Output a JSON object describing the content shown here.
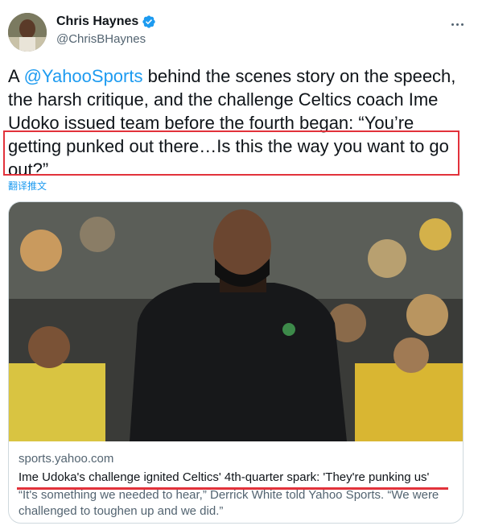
{
  "author": {
    "name": "Chris Haynes",
    "handle": "@ChrisBHaynes",
    "verified": true
  },
  "icons": {
    "verified": "verified-badge-icon",
    "more": "more-options-icon"
  },
  "tweet": {
    "prefix": "A ",
    "mention": "@YahooSports",
    "rest": " behind the scenes story on the speech, the harsh critique, and the challenge Celtics coach Ime Udoko issued team before the fourth began: “You’re getting punked out there…Is this the way you want to go out?”",
    "translate_label": "翻译推文"
  },
  "card": {
    "domain": "sports.yahoo.com",
    "title": "Ime Udoka's challenge ignited Celtics' 4th-quarter spark: 'They're punking us'",
    "description": "“It's something we needed to hear,” Derrick White told Yahoo Sports. “We were challenged to toughen up and we did.”"
  },
  "colors": {
    "link": "#1d9bf0",
    "annotation_red": "#e2323b",
    "muted_text": "#536471",
    "border": "#cfd9de"
  }
}
